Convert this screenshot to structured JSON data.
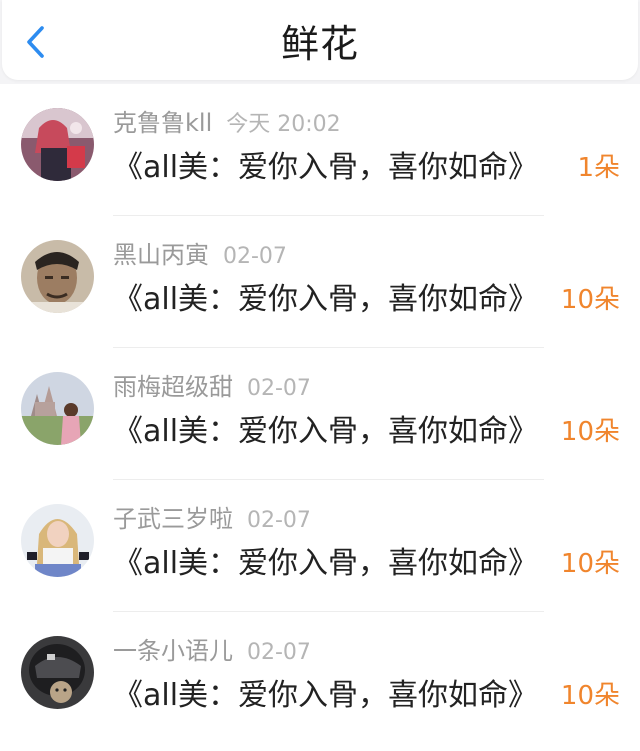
{
  "header": {
    "title": "鲜花",
    "back_icon": "chevron-left-icon"
  },
  "colors": {
    "accent": "#2d8cf0",
    "count": "#f0852d"
  },
  "items": [
    {
      "name": "克鲁鲁kll",
      "time": "今天 20:02",
      "message": "《all美：爱你入骨，喜你如命》",
      "count": "1朵"
    },
    {
      "name": "黑山丙寅",
      "time": "02-07",
      "message": "《all美：爱你入骨，喜你如命》",
      "count": "10朵"
    },
    {
      "name": "雨梅超级甜",
      "time": "02-07",
      "message": "《all美：爱你入骨，喜你如命》",
      "count": "10朵"
    },
    {
      "name": "子武三岁啦",
      "time": "02-07",
      "message": "《all美：爱你入骨，喜你如命》",
      "count": "10朵"
    },
    {
      "name": "一条小语儿",
      "time": "02-07",
      "message": "《all美：爱你入骨，喜你如命》",
      "count": "10朵"
    }
  ]
}
